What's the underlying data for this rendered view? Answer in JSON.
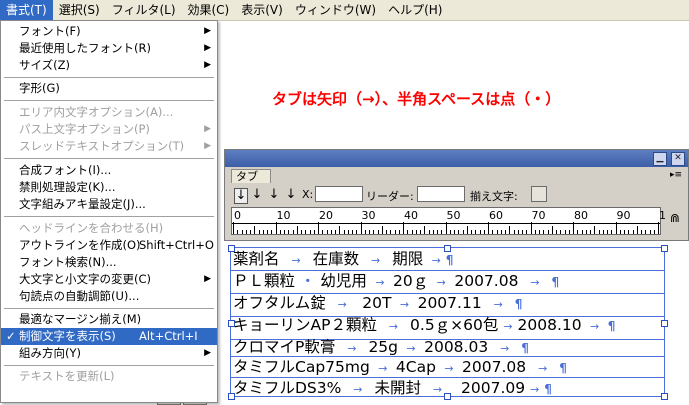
{
  "menubar": {
    "items": [
      {
        "label": "書式(T)"
      },
      {
        "label": "選択(S)"
      },
      {
        "label": "フィルタ(L)"
      },
      {
        "label": "効果(C)"
      },
      {
        "label": "表示(V)"
      },
      {
        "label": "ウィンドウ(W)"
      },
      {
        "label": "ヘルプ(H)"
      }
    ]
  },
  "menu": {
    "items": [
      {
        "label": "フォント(F)"
      },
      {
        "label": "最近使用したフォント(R)"
      },
      {
        "label": "サイズ(Z)"
      },
      {
        "label": "字形(G)"
      },
      {
        "label": "エリア内文字オプション(A)..."
      },
      {
        "label": "パス上文字オプション(P)"
      },
      {
        "label": "スレッドテキストオプション(T)"
      },
      {
        "label": "合成フォント(I)..."
      },
      {
        "label": "禁則処理設定(K)..."
      },
      {
        "label": "文字組みアキ量設定(J)..."
      },
      {
        "label": "ヘッドラインを合わせる(H)"
      },
      {
        "label": "アウトラインを作成(O)",
        "shortcut": "Shift+Ctrl+O"
      },
      {
        "label": "フォント検索(N)..."
      },
      {
        "label": "大文字と小文字の変更(C)"
      },
      {
        "label": "句読点の自動調節(U)..."
      },
      {
        "label": "最適なマージン揃え(M)"
      },
      {
        "label": "制御文字を表示(S)",
        "shortcut": "Alt+Ctrl+I"
      },
      {
        "label": "組み方向(Y)"
      },
      {
        "label": "テキストを更新(L)"
      }
    ]
  },
  "annotation": "タブは矢印（→）、半角スペースは点（・）",
  "tab_panel": {
    "tab_label": "タブ",
    "x_label": "X:",
    "leader_label": "リーダー:",
    "align_char_label": "揃え文字:",
    "ruler_numbers": [
      "0",
      "10",
      "20",
      "30",
      "40",
      "50",
      "60",
      "70",
      "80",
      "90",
      "1"
    ]
  },
  "text_rows": [
    {
      "cells": [
        "薬剤名",
        "在庫数",
        "期限"
      ]
    },
    {
      "cells": [
        "ＰＬ顆粒",
        "幼児用",
        "20ｇ",
        "2007.08"
      ]
    },
    {
      "cells": [
        "オフタルム錠",
        "20T",
        "2007.11"
      ]
    },
    {
      "cells": [
        "キョーリンAP２顆粒",
        "0.5ｇ×60包",
        "2008.10"
      ]
    },
    {
      "cells": [
        "クロマイP軟膏",
        "25g",
        "2008.03"
      ]
    },
    {
      "cells": [
        "タミフルCap75mg",
        "4Cap",
        "2007.08"
      ]
    },
    {
      "cells": [
        "タミフルDS3%",
        "未開封",
        "2007.09"
      ]
    }
  ],
  "colors": {
    "accent": "#316ac5",
    "annotation": "#ff0000",
    "guide": "#4a6fd8"
  }
}
